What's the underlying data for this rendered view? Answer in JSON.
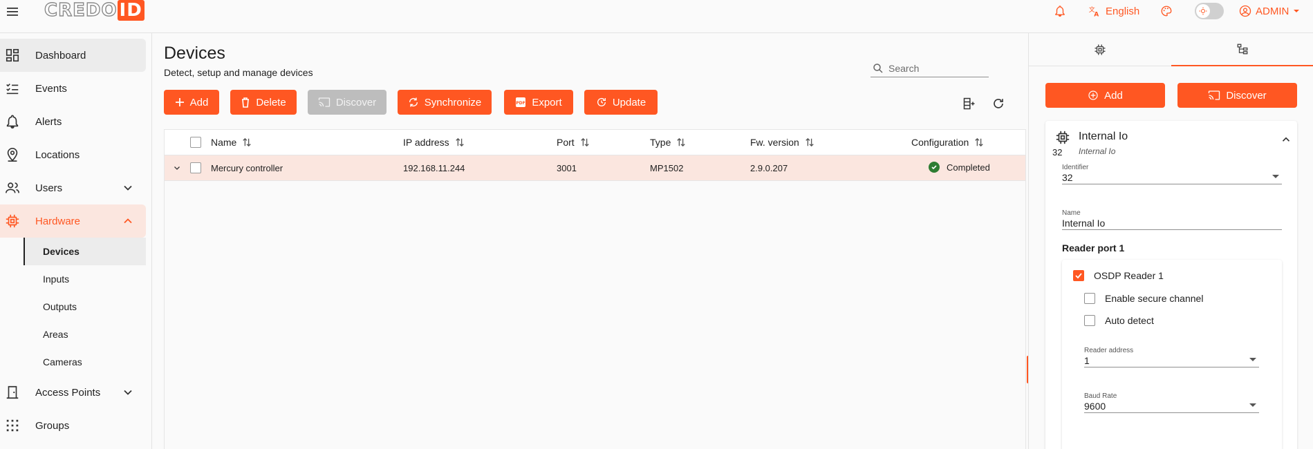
{
  "app": {
    "logo_part1": "CREDO",
    "logo_part2": "ID",
    "language": "English",
    "user": "ADMIN"
  },
  "sidebar": {
    "items": [
      {
        "label": "Dashboard",
        "icon": "dashboard-icon"
      },
      {
        "label": "Events",
        "icon": "events-icon"
      },
      {
        "label": "Alerts",
        "icon": "bell-icon"
      },
      {
        "label": "Locations",
        "icon": "location-icon"
      },
      {
        "label": "Users",
        "icon": "users-icon"
      },
      {
        "label": "Hardware",
        "icon": "chip-icon"
      },
      {
        "label": "Access Points",
        "icon": "door-icon"
      },
      {
        "label": "Groups",
        "icon": "groups-icon"
      }
    ],
    "hardware_sub": [
      "Devices",
      "Inputs",
      "Outputs",
      "Areas",
      "Cameras"
    ]
  },
  "main": {
    "title": "Devices",
    "subtitle": "Detect, setup and manage devices",
    "search_placeholder": "Search",
    "buttons": {
      "add": "Add",
      "delete": "Delete",
      "discover": "Discover",
      "synchronize": "Synchronize",
      "export": "Export",
      "update": "Update"
    },
    "table": {
      "columns": [
        "Name",
        "IP address",
        "Port",
        "Type",
        "Fw. version",
        "Configuration"
      ],
      "rows": [
        {
          "name": "Mercury controller",
          "ip": "192.168.11.244",
          "port": "3001",
          "type": "MP1502",
          "fw": "2.9.0.207",
          "config": "Completed"
        }
      ]
    }
  },
  "panel": {
    "add": "Add",
    "discover": "Discover",
    "card": {
      "number": "32",
      "title": "Internal Io",
      "subtitle": "Internal Io",
      "identifier_label": "Identifier",
      "identifier_value": "32",
      "name_label": "Name",
      "name_value": "Internal Io",
      "section": "Reader port 1",
      "osdp_label": "OSDP Reader 1",
      "osdp_checked": true,
      "secure_label": "Enable secure channel",
      "secure_checked": false,
      "auto_label": "Auto detect",
      "auto_checked": false,
      "reader_address_label": "Reader address",
      "reader_address_value": "1",
      "baud_label": "Baud Rate",
      "baud_value": "9600"
    }
  },
  "colors": {
    "accent": "#ff5722",
    "selected_row": "#fbe6df",
    "success": "#2e7d32"
  }
}
